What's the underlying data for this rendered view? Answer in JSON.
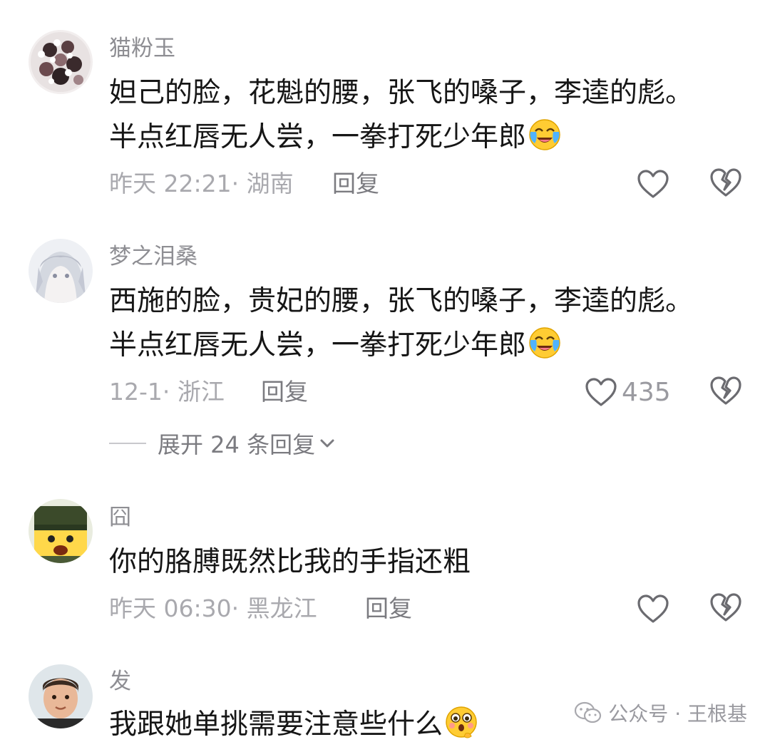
{
  "comments": [
    {
      "username": "猫粉玉",
      "text_line1": "妲己的脸，花魁的腰，张飞的嗓子，李逵的彪。",
      "text_line2": "半点红唇无人尝，一拳打死少年郎",
      "text_emoji": "crying-laughing-emoji",
      "meta": "昨天 22:21· 湖南",
      "reply_label": "回复",
      "like_count": ""
    },
    {
      "username": "梦之泪桑",
      "text_line1": "西施的脸，贵妃的腰，张飞的嗓子，李逵的彪。",
      "text_line2": "半点红唇无人尝，一拳打死少年郎",
      "text_emoji": "crying-laughing-emoji",
      "meta": "12-1· 浙江",
      "reply_label": "回复",
      "like_count": "435",
      "expand_label": "展开 24 条回复"
    },
    {
      "username": "囧",
      "text_line1": "你的胳膊既然比我的手指还粗",
      "meta": "昨天 06:30· 黑龙江",
      "reply_label": "回复",
      "like_count": ""
    },
    {
      "username": "发",
      "text_line1": "我跟她单挑需要注意些什么",
      "text_emoji": "thinking-flushed-emoji"
    }
  ],
  "watermark": {
    "label": "公众号 · 王根基",
    "icon": "wechat-icon"
  },
  "colors": {
    "text": "#161616",
    "username": "#8e8e93",
    "meta": "#a9a9ae",
    "icon": "#6b6b70"
  }
}
